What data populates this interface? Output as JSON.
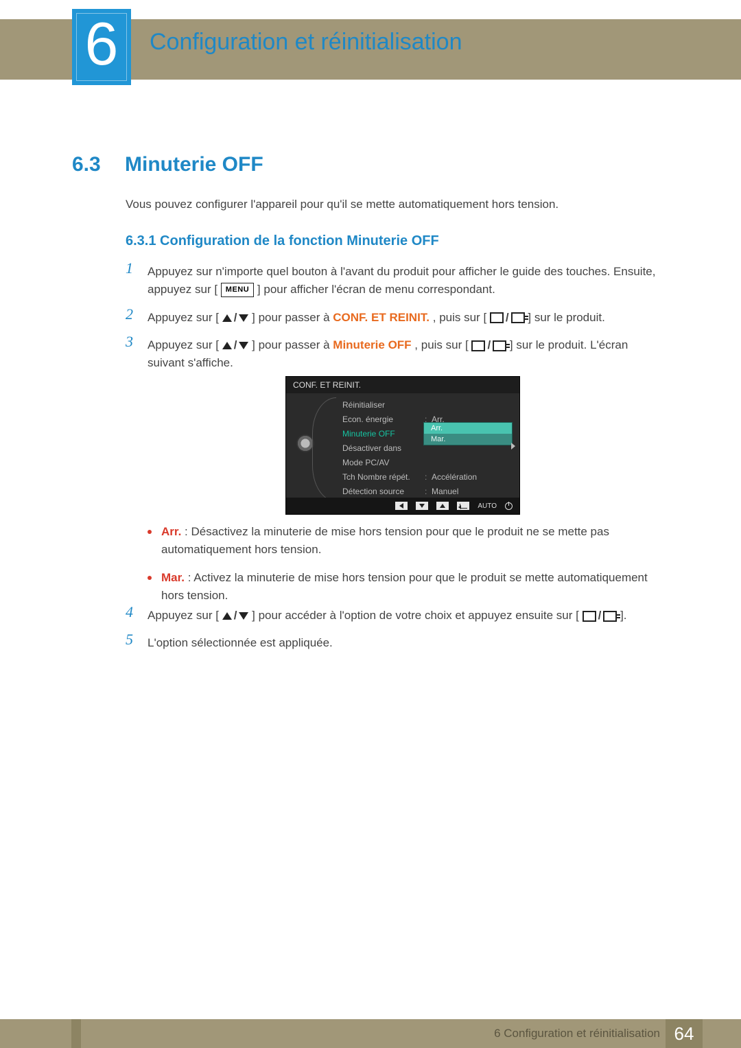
{
  "chapter": {
    "number": "6",
    "title": "Configuration et réinitialisation"
  },
  "section": {
    "number": "6.3",
    "title": "Minuterie OFF"
  },
  "intro": "Vous pouvez configurer l'appareil pour qu'il se mette automatiquement hors tension.",
  "subsection": "6.3.1   Configuration de la fonction Minuterie OFF",
  "menu_label": "MENU",
  "steps": {
    "s1a": "Appuyez sur n'importe quel bouton à l'avant du produit pour afficher le guide des touches. Ensuite, appuyez sur [",
    "s1b": "] pour afficher l'écran de menu correspondant.",
    "s2a": "Appuyez sur [",
    "s2b": "] pour passer à ",
    "s2_kw": "CONF. ET REINIT.",
    "s2c": ", puis sur [",
    "s2d": "] sur le produit.",
    "s3a": "Appuyez sur [",
    "s3b": "] pour passer à ",
    "s3_kw": "Minuterie OFF",
    "s3c": ", puis sur [",
    "s3d": "] sur le produit. L'écran suivant s'affiche.",
    "s4a": "Appuyez sur [",
    "s4b": "] pour accéder à l'option de votre choix et appuyez ensuite sur [",
    "s4c": "].",
    "s5": "L'option sélectionnée est appliquée."
  },
  "bullets": {
    "arr_kw": "Arr.",
    "arr_txt": " : Désactivez la minuterie de mise hors tension pour que le produit ne se mette pas automatiquement hors tension.",
    "mar_kw": "Mar.",
    "mar_txt": " : Activez la minuterie de mise hors tension pour que le produit se mette automatiquement hors tension."
  },
  "osd": {
    "title": "CONF. ET REINIT.",
    "rows": [
      {
        "label": "Réinitialiser",
        "val": ""
      },
      {
        "label": "Econ. énergie",
        "val": "Arr."
      },
      {
        "label": "Minuterie OFF",
        "val": ""
      },
      {
        "label": "Désactiver dans",
        "val": ""
      },
      {
        "label": "Mode PC/AV",
        "val": ""
      },
      {
        "label": "Tch Nombre répét.",
        "val": "Accélération"
      },
      {
        "label": "Détection source",
        "val": "Manuel"
      }
    ],
    "dropdown": {
      "opt1": "Arr.",
      "opt2": "Mar."
    },
    "footer_auto": "AUTO"
  },
  "footer": {
    "text": "6 Configuration et réinitialisation",
    "page": "64"
  }
}
